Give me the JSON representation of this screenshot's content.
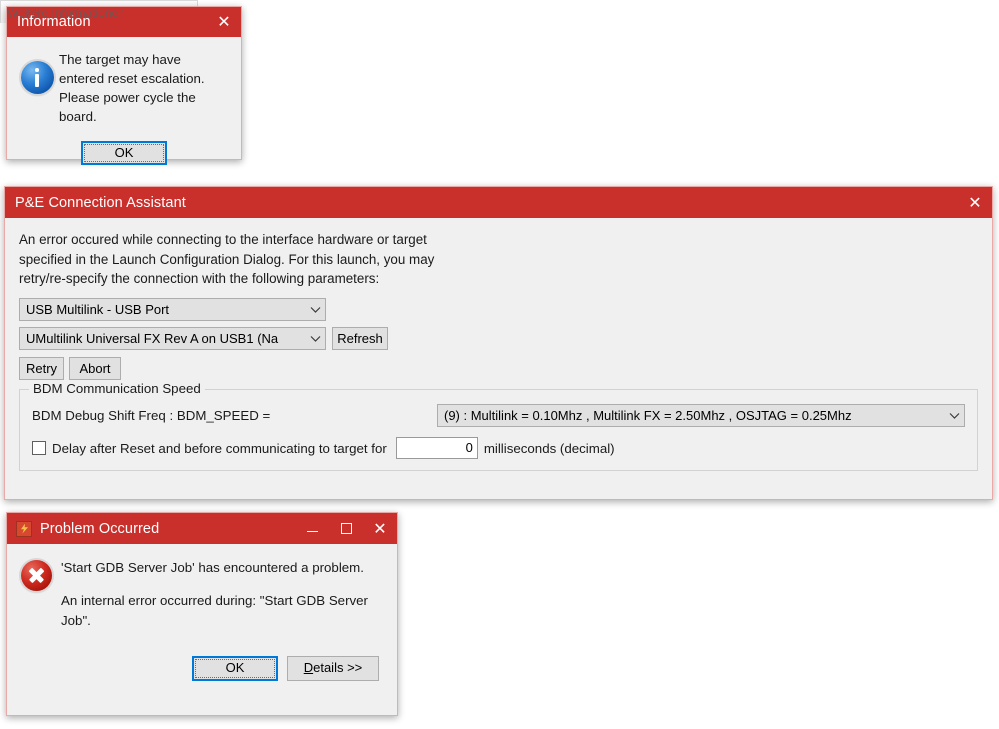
{
  "information_dialog": {
    "title": "Information",
    "close_icon": "close-icon",
    "icon": "info-icon",
    "message": "The target may have entered reset escalation. Please power cycle the board.",
    "ok_label": "OK"
  },
  "background_window": {
    "obscured_text": "Weitere Informationen"
  },
  "pe_dialog": {
    "title": "P&E Connection Assistant",
    "close_icon": "close-icon",
    "paragraph": "An error occured while connecting to the interface hardware or target specified in the Launch Configuration Dialog. For this launch, you may retry/re-specify the connection with the following parameters:",
    "interface_combo": {
      "value": "USB Multilink - USB Port",
      "chevron_icon": "chevron-down-icon"
    },
    "port_combo": {
      "value": "UMultilink Universal FX Rev A on USB1 (Na",
      "chevron_icon": "chevron-down-icon"
    },
    "refresh_label": "Refresh",
    "retry_label": "Retry",
    "abort_label": "Abort",
    "bdm_group": {
      "legend": "BDM Communication Speed",
      "shift_freq_label": "BDM Debug Shift Freq : BDM_SPEED =",
      "speed_combo": {
        "value": "(9)  :  Multilink = 0.10Mhz ,  Multilink FX =  2.50Mhz ,  OSJTAG = 0.25Mhz",
        "chevron_icon": "chevron-down-icon"
      },
      "delay_checkbox_label": "Delay after Reset and before communicating to target for",
      "delay_checked": false,
      "delay_value": "0",
      "delay_units": "milliseconds (decimal)"
    }
  },
  "problem_dialog": {
    "title": "Problem Occurred",
    "app_icon": "eclipse-icon",
    "minimize_icon": "minimize-icon",
    "maximize_icon": "maximize-icon",
    "close_icon": "close-icon",
    "status_icon": "error-icon",
    "primary_message": "'Start GDB Server Job' has encountered a problem.",
    "secondary_message": "An internal error occurred during: \"Start GDB Server Job\".",
    "ok_label": "OK",
    "details_label": "Details >>",
    "details_mnemonic": "D"
  },
  "colors": {
    "titlebar": "#c9302c",
    "dialog_bg": "#f0f0f0",
    "dialog_border": "#e8a9a7",
    "focus_blue": "#0078d7",
    "error_red": "#cf2b21",
    "info_blue": "#2a7fd4"
  }
}
